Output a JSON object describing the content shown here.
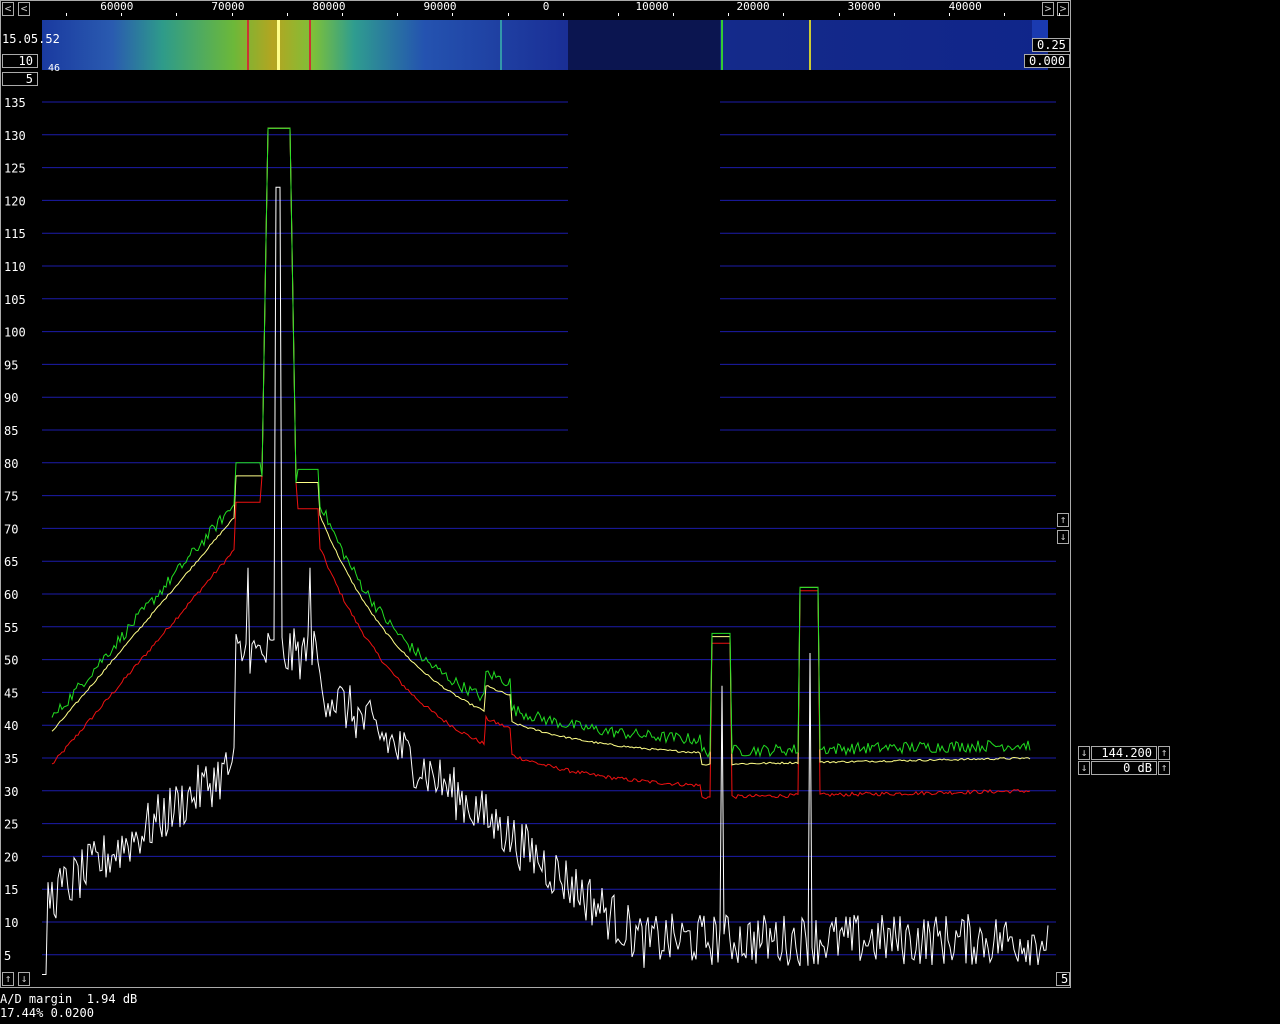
{
  "window": {
    "title_scroll": {
      "left": "<",
      "right": ">"
    }
  },
  "frequency_axis": {
    "labels": [
      {
        "text": "60000",
        "pos": 0.08
      },
      {
        "text": "70000",
        "pos": 0.19
      },
      {
        "text": "80000",
        "pos": 0.29
      },
      {
        "text": "90000",
        "pos": 0.4
      },
      {
        "text": "0",
        "pos": 0.505
      },
      {
        "text": "10000",
        "pos": 0.61
      },
      {
        "text": "20000",
        "pos": 0.71
      },
      {
        "text": "30000",
        "pos": 0.82
      },
      {
        "text": "40000",
        "pos": 0.92
      }
    ]
  },
  "waterfall": {
    "time": "15.05.52",
    "avg_box": "10",
    "small_number": "46",
    "param_box": "5",
    "gain": "0.25",
    "offset": "0.000"
  },
  "spectrum": {
    "y_labels": [
      "135",
      "130",
      "125",
      "120",
      "115",
      "110",
      "105",
      "100",
      "95",
      "90",
      "85",
      "80",
      "75",
      "70",
      "65",
      "60",
      "55",
      "50",
      "45",
      "40",
      "35",
      "30",
      "25",
      "20",
      "15",
      "10",
      "5"
    ],
    "bottom_right_box": "5",
    "scroll_up": "↑",
    "scroll_down": "↓"
  },
  "right_panel": {
    "frequency": "144.200",
    "gain_db": "0 dB",
    "arrow_up": "↑",
    "arrow_down": "↓"
  },
  "status": {
    "ad_margin": "A/D margin  1.94 dB",
    "cpu": "17.44% 0.0200"
  },
  "colors": {
    "grid": "#1c1caa",
    "green": "#22dd22",
    "yellow": "#ffff88",
    "red": "#ee1111",
    "white": "#ffffff"
  }
}
